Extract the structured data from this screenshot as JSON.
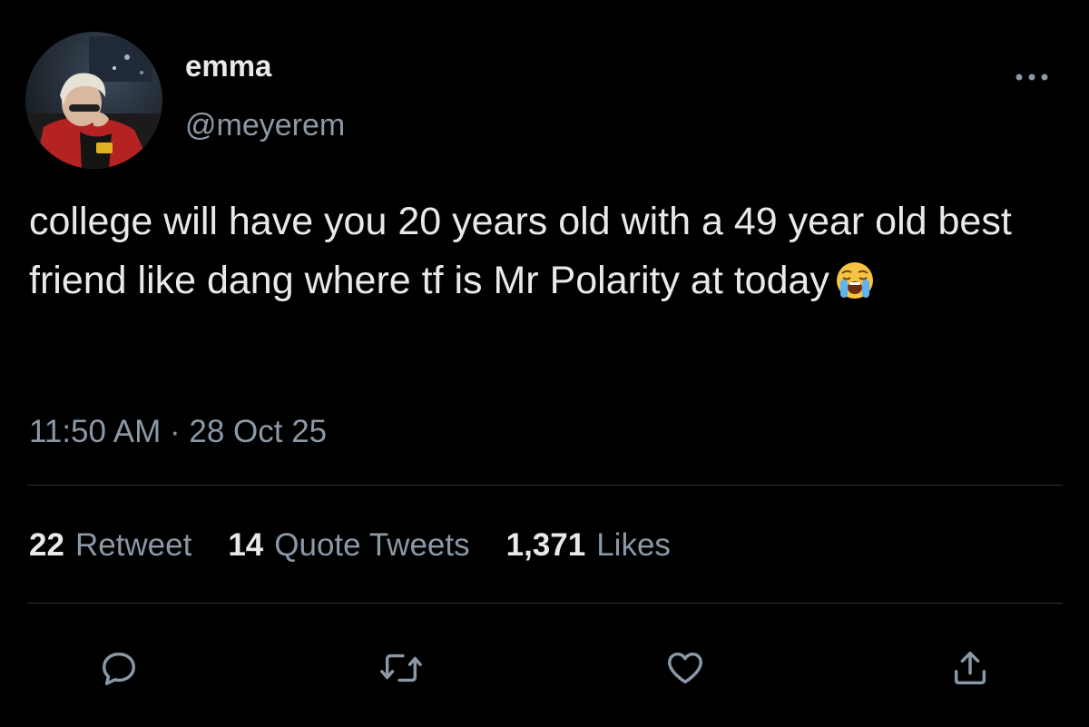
{
  "author": {
    "display_name": "emma",
    "handle": "@meyerem"
  },
  "tweet": {
    "text": "college will have you 20 years old with a 49 year old best friend like dang where tf is Mr Polarity at today",
    "emoji": "loudly-crying-face",
    "timestamp": "11:50 AM · 28 Oct 25"
  },
  "stats": {
    "retweets_count": "22",
    "retweets_label": "Retweet",
    "quotes_count": "14",
    "quotes_label": "Quote Tweets",
    "likes_count": "1,371",
    "likes_label": "Likes"
  },
  "actions": {
    "reply_icon": "reply-icon",
    "retweet_icon": "retweet-icon",
    "like_icon": "heart-icon",
    "share_icon": "share-icon"
  },
  "colors": {
    "background": "#000000",
    "primary_text": "#e7e9ea",
    "secondary_text": "#8b98a5",
    "divider": "#2f3336"
  }
}
